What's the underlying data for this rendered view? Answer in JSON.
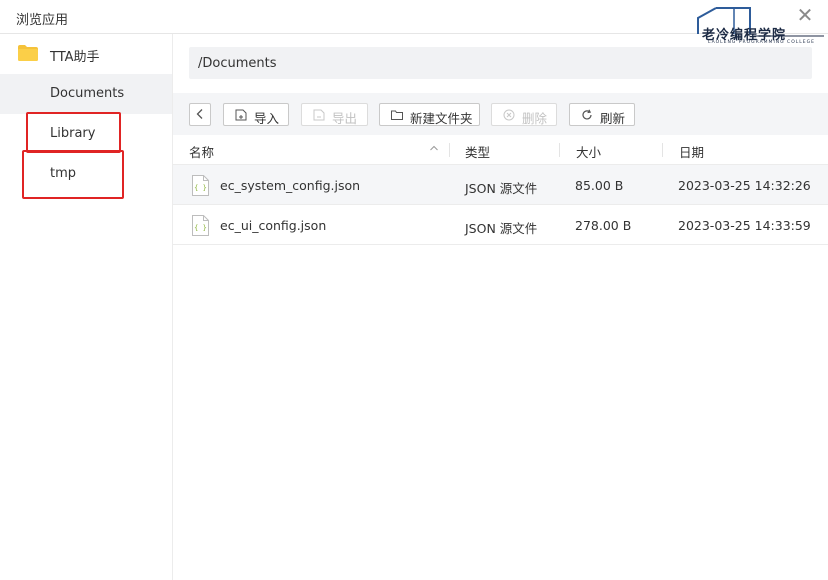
{
  "window": {
    "title": "浏览应用",
    "close_glyph": "✕"
  },
  "watermark": {
    "main": "老冷编程学院",
    "sub": "LAOLENG PROGRAMMING COLLEGE"
  },
  "sidebar": {
    "root": {
      "label": "TTA助手",
      "icon": "folder-icon"
    },
    "items": [
      {
        "label": "Documents",
        "active": true
      },
      {
        "label": "Library",
        "active": false
      },
      {
        "label": "tmp",
        "active": false
      }
    ]
  },
  "path": {
    "value": "/Documents"
  },
  "toolbar": {
    "import_label": "导入",
    "export_label": "导出",
    "new_folder_label": "新建文件夹",
    "delete_label": "删除",
    "refresh_label": "刷新"
  },
  "table": {
    "columns": [
      "名称",
      "类型",
      "大小",
      "日期"
    ],
    "rows": [
      {
        "name": "ec_system_config.json",
        "type": "JSON 源文件",
        "size": "85.00 B",
        "date": "2023-03-25 14:32:26"
      },
      {
        "name": "ec_ui_config.json",
        "type": "JSON 源文件",
        "size": "278.00 B",
        "date": "2023-03-25 14:33:59"
      }
    ]
  },
  "colors": {
    "accent_red": "#e02424",
    "folder_yellow": "#f5c23a",
    "file_icon_green": "#8cb43a"
  }
}
